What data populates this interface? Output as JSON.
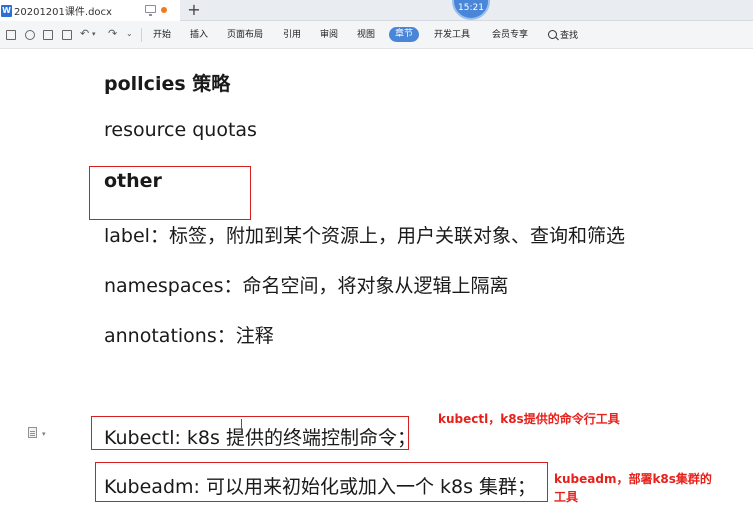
{
  "tab": {
    "doc_icon": "W",
    "doc_title": "20201201课件.docx",
    "new_tab_symbol": "+",
    "clock": "15:21"
  },
  "toolbar": {
    "quick_access_icons": [
      "save-icon",
      "redo-icon",
      "print-icon",
      "preview-icon",
      "undo-icon",
      "redo-arrow-icon",
      "customize-icon"
    ],
    "menu": [
      {
        "label": "开始",
        "active": false
      },
      {
        "label": "插入",
        "active": false
      },
      {
        "label": "页面布局",
        "active": false
      },
      {
        "label": "引用",
        "active": false
      },
      {
        "label": "审阅",
        "active": false
      },
      {
        "label": "视图",
        "active": false
      },
      {
        "label": "章节",
        "active": true
      },
      {
        "label": "开发工具",
        "active": false
      },
      {
        "label": "会员专享",
        "active": false
      }
    ],
    "find_label": "查找"
  },
  "document": {
    "line1": "pollcies 策略",
    "line2": "resource quotas",
    "line3": "other",
    "line4": "label：标签，附加到某个资源上，用户关联对象、查询和筛选",
    "line5": "namespaces：命名空间，将对象从逻辑上隔离",
    "line6": "annotations：注释",
    "line7": "Kubectl: k8s 提供的终端控制命令；",
    "line8": "Kubeadm:  可以用来初始化或加入一个 k8s 集群；"
  },
  "annotations": {
    "kubectl_note": "kubectl，k8s提供的命令行工具",
    "kubeadm_note_1": "kubeadm，部署k8s集群的",
    "kubeadm_note_2": "工具"
  },
  "colors": {
    "accent": "#4a86d8",
    "annotation_red": "#e8201a",
    "box_red": "#d62020"
  }
}
